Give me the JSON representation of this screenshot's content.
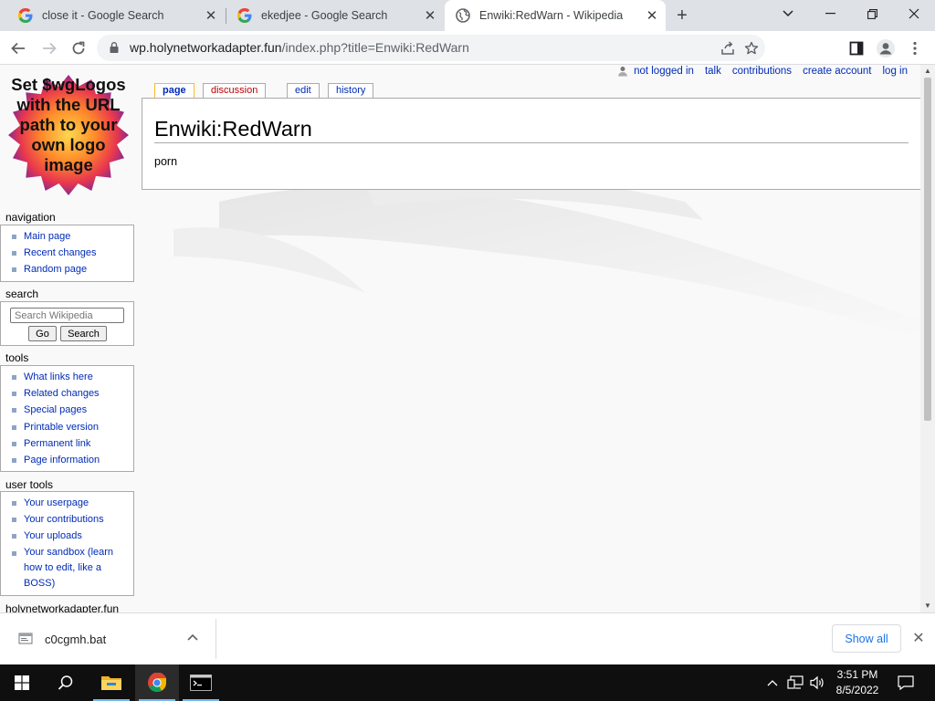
{
  "browser": {
    "tabs": [
      {
        "title": "close it - Google Search"
      },
      {
        "title": "ekedjee - Google Search"
      },
      {
        "title": "Enwiki:RedWarn - Wikipedia"
      }
    ],
    "url_host": "wp.holynetworkadapter.fun",
    "url_path": "/index.php?title=Enwiki:RedWarn"
  },
  "wiki": {
    "personal": [
      "not logged in",
      "talk",
      "contributions",
      "create account",
      "log in"
    ],
    "logo_text": "Set $wgLogos with the URL path to your own logo image",
    "page_tabs": [
      "page",
      "discussion",
      "edit",
      "history"
    ],
    "title": "Enwiki:RedWarn",
    "body_text": "porn",
    "navigation": {
      "heading": "navigation",
      "items": [
        "Main page",
        "Recent changes",
        "Random page"
      ]
    },
    "search": {
      "heading": "search",
      "placeholder": "Search Wikipedia",
      "go_label": "Go",
      "search_label": "Search"
    },
    "tools": {
      "heading": "tools",
      "items": [
        "What links here",
        "Related changes",
        "Special pages",
        "Printable version",
        "Permanent link",
        "Page information"
      ]
    },
    "user_tools": {
      "heading": "user tools",
      "items": [
        "Your userpage",
        "Your contributions",
        "Your uploads",
        "Your sandbox (learn how to edit, like a BOSS)"
      ]
    },
    "site_heading": "holynetworkadapter.fun"
  },
  "downloads": {
    "file": "c0cgmh.bat",
    "show_all": "Show all"
  },
  "taskbar": {
    "time": "3:51 PM",
    "date": "8/5/2022"
  },
  "colors": {
    "link": "#002bb8",
    "new_link": "#ba0000",
    "accent_blue": "#1a73e8",
    "taskbar": "#0f0f0f"
  },
  "icons": [
    "google-favicon-icon",
    "globe-favicon-icon",
    "lock-icon",
    "share-icon",
    "star-icon",
    "sidepanel-icon",
    "profile-icon",
    "menu-icon",
    "user-icon",
    "file-icon",
    "windows-start-icon",
    "search-icon",
    "file-explorer-icon",
    "chrome-icon",
    "terminal-icon",
    "network-icon",
    "volume-icon",
    "notification-icon"
  ]
}
